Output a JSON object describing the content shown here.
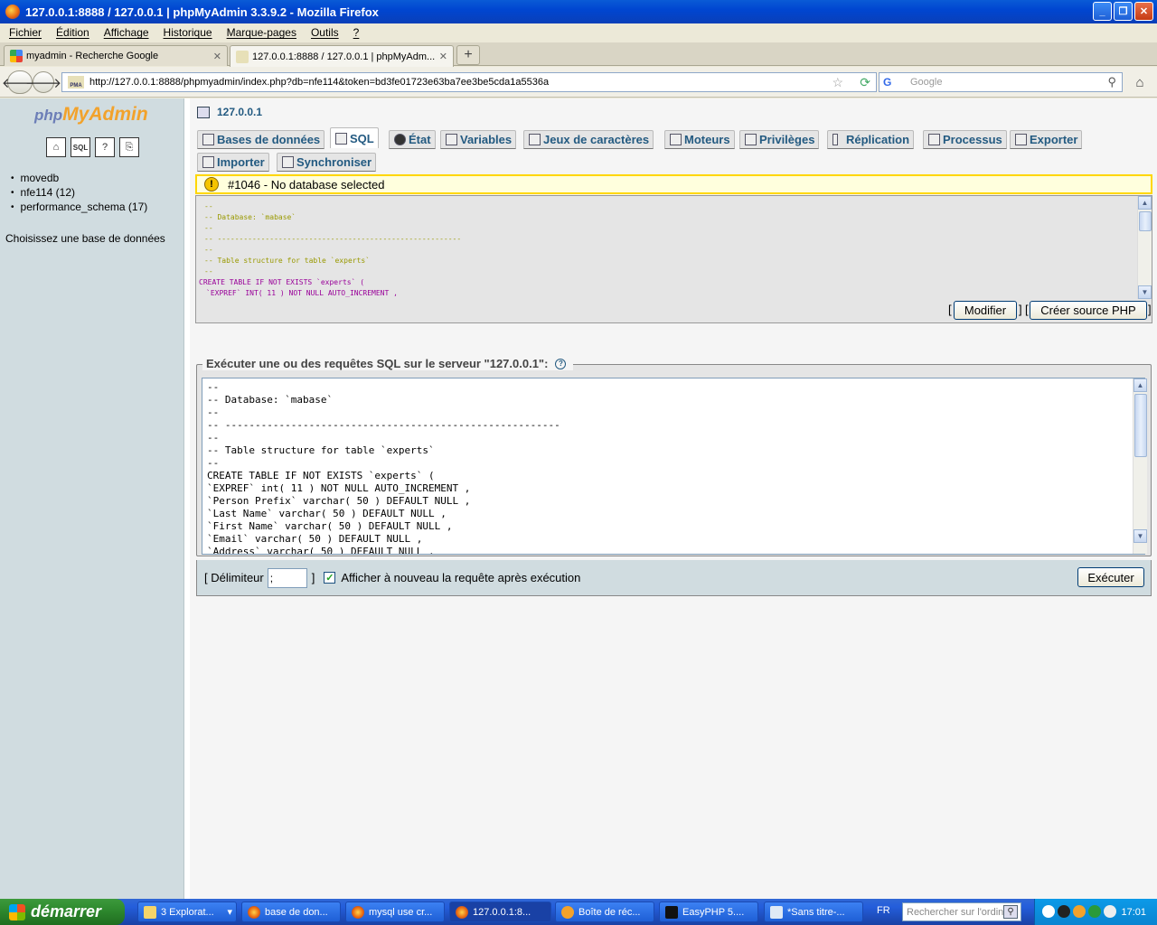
{
  "window": {
    "title": "127.0.0.1:8888 / 127.0.0.1 | phpMyAdmin 3.3.9.2 - Mozilla Firefox",
    "minimize": "_",
    "maximize": "❐",
    "close": "✕"
  },
  "menu": [
    "Fichier",
    "Édition",
    "Affichage",
    "Historique",
    "Marque-pages",
    "Outils",
    "?"
  ],
  "browser_tabs": [
    {
      "label": "myadmin - Recherche Google",
      "close": "✕"
    },
    {
      "label": "127.0.0.1:8888 / 127.0.0.1 | phpMyAdm...",
      "close": "✕"
    }
  ],
  "new_tab": "+",
  "nav": {
    "back": "🡐",
    "forward": "🡒",
    "url": "http://127.0.0.1:8888/phpmyadmin/index.php?db=nfe114&token=bd3fe01723e63ba7ee3be5cda1a5536a",
    "pma_favicon": "PMA",
    "star": "☆",
    "reload": "⟳",
    "search_engine_letter": "G",
    "search_placeholder": "Google",
    "search_mag": "⚲",
    "home": "⌂"
  },
  "left": {
    "logo_php": "php",
    "logo_my": "My",
    "logo_admin": "Admin",
    "icons": [
      "⌂",
      "SQL",
      "?",
      "⎘"
    ],
    "databases": [
      "movedb",
      "nfe114 (12)",
      "performance_schema (17)"
    ],
    "choose_text": "Choisissez une base de données"
  },
  "main": {
    "server_label": "127.0.0.1",
    "tabs": [
      "Bases de données",
      "SQL",
      "État",
      "Variables",
      "Jeux de caractères",
      "Moteurs",
      "Privilèges",
      "Réplication",
      "Processus",
      "Exporter",
      "Importer",
      "Synchroniser"
    ],
    "error_icon": "!",
    "error_text": "#1046 - No database selected",
    "sql_preview": {
      "lines": [
        "--",
        "-- Database: `mabase`",
        "--",
        "-- --------------------------------------------------------",
        "--",
        "-- Table structure for table `experts`",
        "--",
        "CREATE TABLE IF NOT EXISTS `experts` (",
        "`EXPREF` INT( 11 ) NOT NULL AUTO_INCREMENT ,"
      ]
    },
    "buttons": {
      "modify": "Modifier",
      "php_source": "Créer source PHP"
    },
    "brackets": {
      "open": "[",
      "close": "]"
    },
    "query_legend": "Exécuter une ou des requêtes SQL sur le serveur \"127.0.0.1\":",
    "help_icon": "?",
    "query_text": "--\n-- Database: `mabase`\n--\n-- --------------------------------------------------------\n--\n-- Table structure for table `experts`\n--\nCREATE TABLE IF NOT EXISTS `experts` (\n`EXPREF` int( 11 ) NOT NULL AUTO_INCREMENT ,\n`Person Prefix` varchar( 50 ) DEFAULT NULL ,\n`Last Name` varchar( 50 ) DEFAULT NULL ,\n`First Name` varchar( 50 ) DEFAULT NULL ,\n`Email` varchar( 50 ) DEFAULT NULL ,\n`Address` varchar( 50 ) DEFAULT NULL ,",
    "delimiter_label": "[ Délimiteur",
    "delimiter_value": ";",
    "delimiter_close": "]",
    "checkbox_label": "Afficher à nouveau la requête après exécution",
    "checkbox_mark": "✓",
    "execute_label": "Exécuter",
    "scroll_up": "▲",
    "scroll_down": "▼"
  },
  "taskbar": {
    "start": "démarrer",
    "tasks": [
      "3 Explorat...",
      "base de don...",
      "mysql use cr...",
      "127.0.0.1:8...",
      "Boîte de réc...",
      "EasyPHP 5....",
      "*Sans titre-..."
    ],
    "task_dropdown": "▾",
    "lang": "FR",
    "search_placeholder": "Rechercher sur l'ordin",
    "search_mag": "⚲",
    "clock": "17:01"
  }
}
